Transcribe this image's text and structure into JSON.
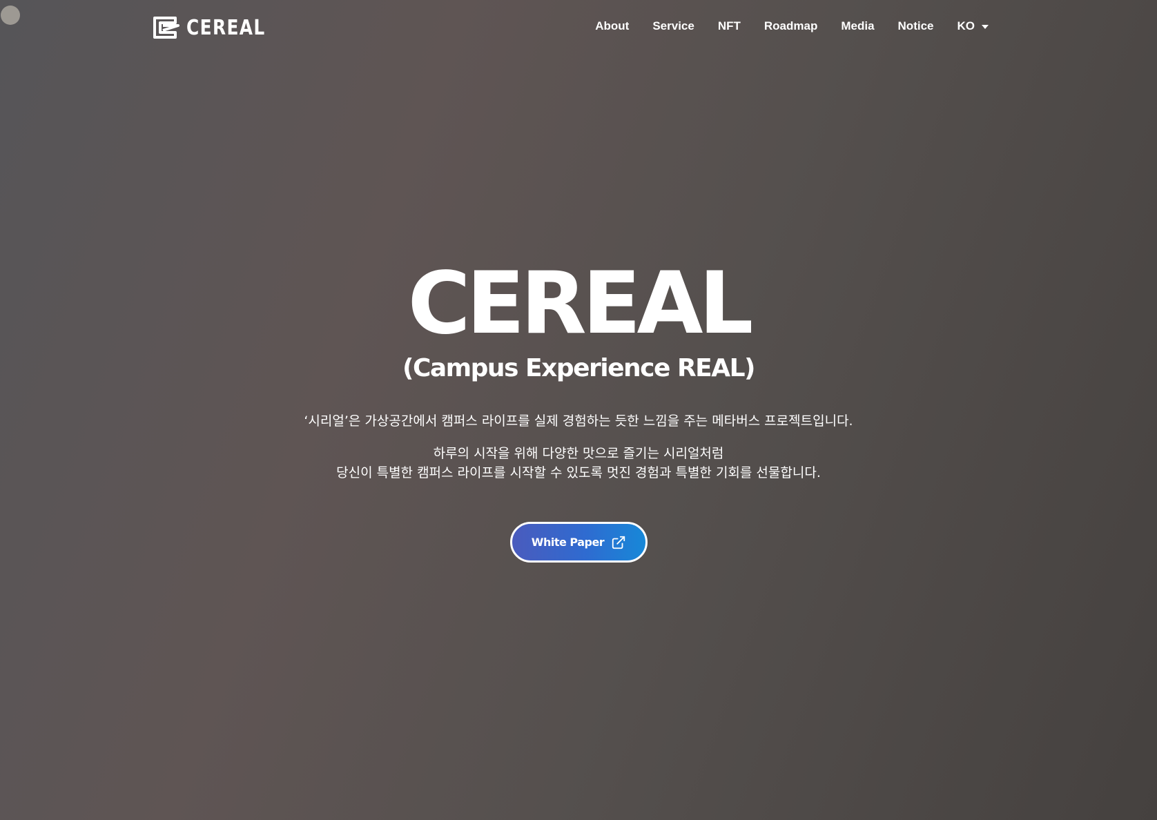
{
  "header": {
    "logo_text": "CEREAL",
    "nav": [
      {
        "label": "About"
      },
      {
        "label": "Service"
      },
      {
        "label": "NFT"
      },
      {
        "label": "Roadmap"
      },
      {
        "label": "Media"
      },
      {
        "label": "Notice"
      }
    ],
    "language": "KO"
  },
  "hero": {
    "title": "CEREAL",
    "subtitle": "(Campus Experience REAL)",
    "description_1": "‘시리얼’은 가상공간에서 캠퍼스 라이프를 실제 경험하는 듯한 느낌을 주는 메타버스 프로젝트입니다.",
    "description_2_line1": "하루의 시작을 위해 다양한 맛으로 즐기는 시리얼처럼",
    "description_2_line2": "당신이 특별한 캠퍼스 라이프를 시작할 수 있도록 멋진 경험과 특별한 기회를 선물합니다.",
    "button_label": "White Paper"
  },
  "icons": {
    "logo": "cereal-logo-icon",
    "language_dropdown": "caret-down-icon",
    "external_link": "external-link-icon"
  },
  "colors": {
    "background_start": "#565558",
    "background_end": "#45413f",
    "button_gradient_start": "#4a5bbd",
    "button_gradient_end": "#1788d8",
    "text": "#ffffff"
  }
}
